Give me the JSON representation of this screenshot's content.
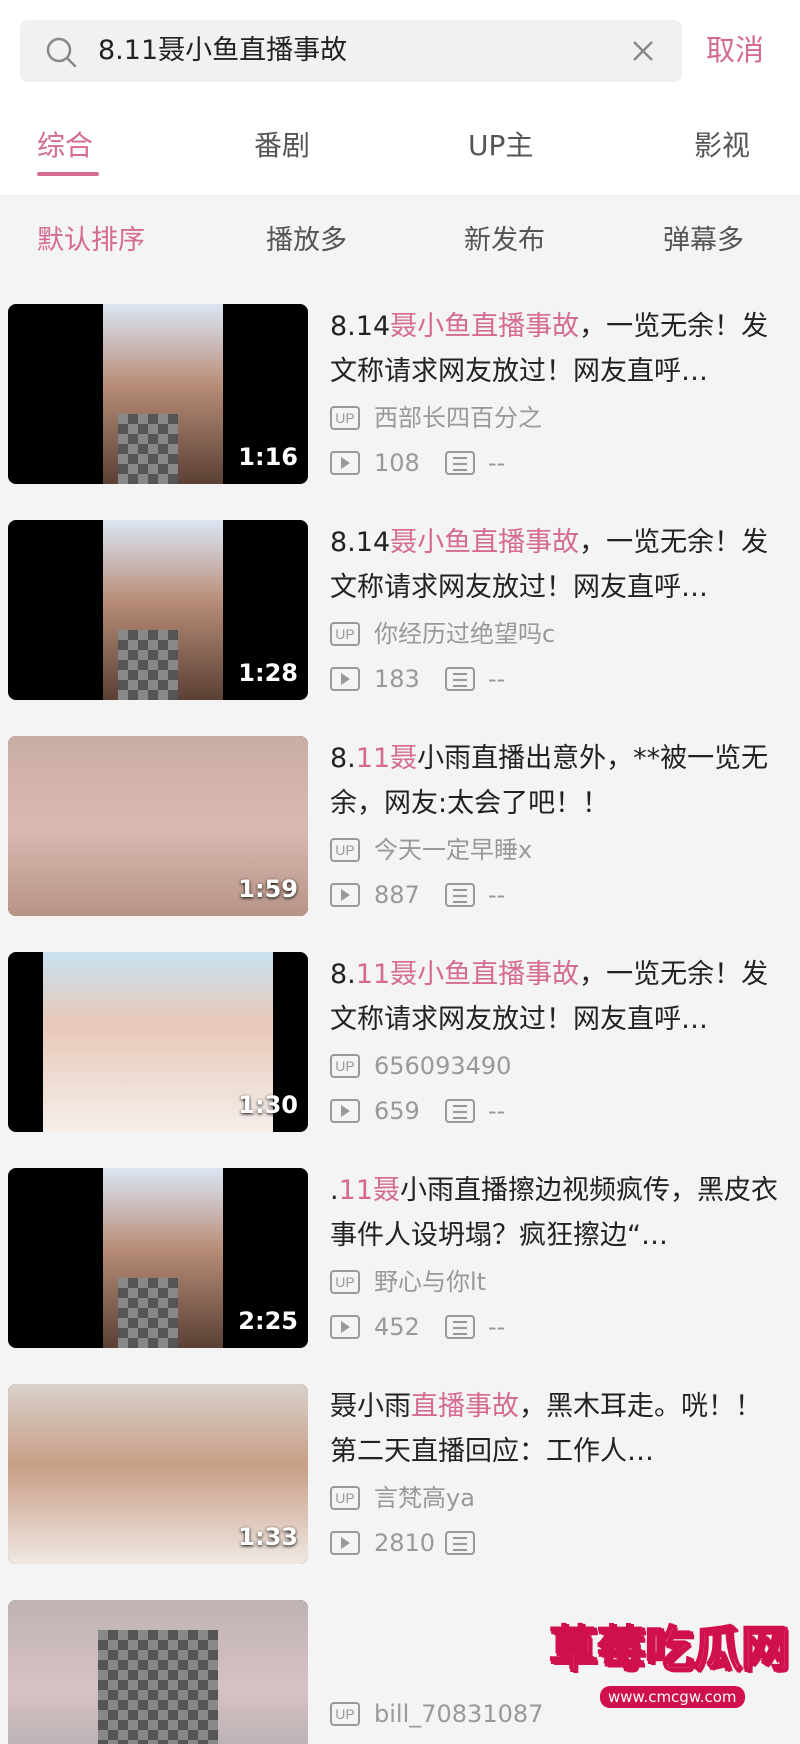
{
  "search": {
    "query": "8.11聂小鱼直播事故",
    "cancel_label": "取消"
  },
  "tabs": [
    {
      "label": "综合",
      "active": true
    },
    {
      "label": "番剧",
      "active": false
    },
    {
      "label": "UP主",
      "active": false
    },
    {
      "label": "影视",
      "active": false
    }
  ],
  "sort": [
    {
      "label": "默认排序",
      "active": true
    },
    {
      "label": "播放多",
      "active": false
    },
    {
      "label": "新发布",
      "active": false
    },
    {
      "label": "弹幕多",
      "active": false
    }
  ],
  "results": [
    {
      "title_parts": [
        {
          "text": "8.14",
          "highlight": false
        },
        {
          "text": "聂小鱼直播事故",
          "highlight": true
        },
        {
          "text": "，一览无余！发文称请求网友放过！网友直呼…",
          "highlight": false
        }
      ],
      "duration": "1:16",
      "up_badge": "UP",
      "uploader": "西部长四百分之",
      "plays": "108",
      "danmaku": "--"
    },
    {
      "title_parts": [
        {
          "text": "8.14",
          "highlight": false
        },
        {
          "text": "聂小鱼直播事故",
          "highlight": true
        },
        {
          "text": "，一览无余！发文称请求网友放过！网友直呼…",
          "highlight": false
        }
      ],
      "duration": "1:28",
      "up_badge": "UP",
      "uploader": "你经历过绝望吗c",
      "plays": "183",
      "danmaku": "--"
    },
    {
      "title_parts": [
        {
          "text": "8.",
          "highlight": false
        },
        {
          "text": "11聂",
          "highlight": true
        },
        {
          "text": "小雨直播出意外，**被一览无余，网友:太会了吧！！",
          "highlight": false
        }
      ],
      "duration": "1:59",
      "up_badge": "UP",
      "uploader": "今天一定早睡x",
      "plays": "887",
      "danmaku": "--"
    },
    {
      "title_parts": [
        {
          "text": "8.",
          "highlight": false
        },
        {
          "text": "11聂小鱼直播事故",
          "highlight": true
        },
        {
          "text": "，一览无余！发文称请求网友放过！网友直呼…",
          "highlight": false
        }
      ],
      "duration": "1:30",
      "up_badge": "UP",
      "uploader": "656093490",
      "plays": "659",
      "danmaku": "--"
    },
    {
      "title_parts": [
        {
          "text": ".",
          "highlight": false
        },
        {
          "text": "11聂",
          "highlight": true
        },
        {
          "text": "小雨直播擦边视频疯传，黑皮衣事件人设坍塌？疯狂擦边“…",
          "highlight": false
        }
      ],
      "duration": "2:25",
      "up_badge": "UP",
      "uploader": "野心与你lt",
      "plays": "452",
      "danmaku": "--"
    },
    {
      "title_parts": [
        {
          "text": "聂小雨",
          "highlight": false
        },
        {
          "text": "直播事故",
          "highlight": true
        },
        {
          "text": "，黑木耳走。咣！！ 第二天直播回应：工作人…",
          "highlight": false
        }
      ],
      "duration": "1:33",
      "up_badge": "UP",
      "uploader": "言梵高ya",
      "plays": "2810",
      "danmaku": ""
    }
  ],
  "partial_result": {
    "up_badge": "UP",
    "uploader": "bill_70831087"
  },
  "watermark": {
    "title": "草莓吃瓜网",
    "url": "www.cmcgw.com"
  }
}
